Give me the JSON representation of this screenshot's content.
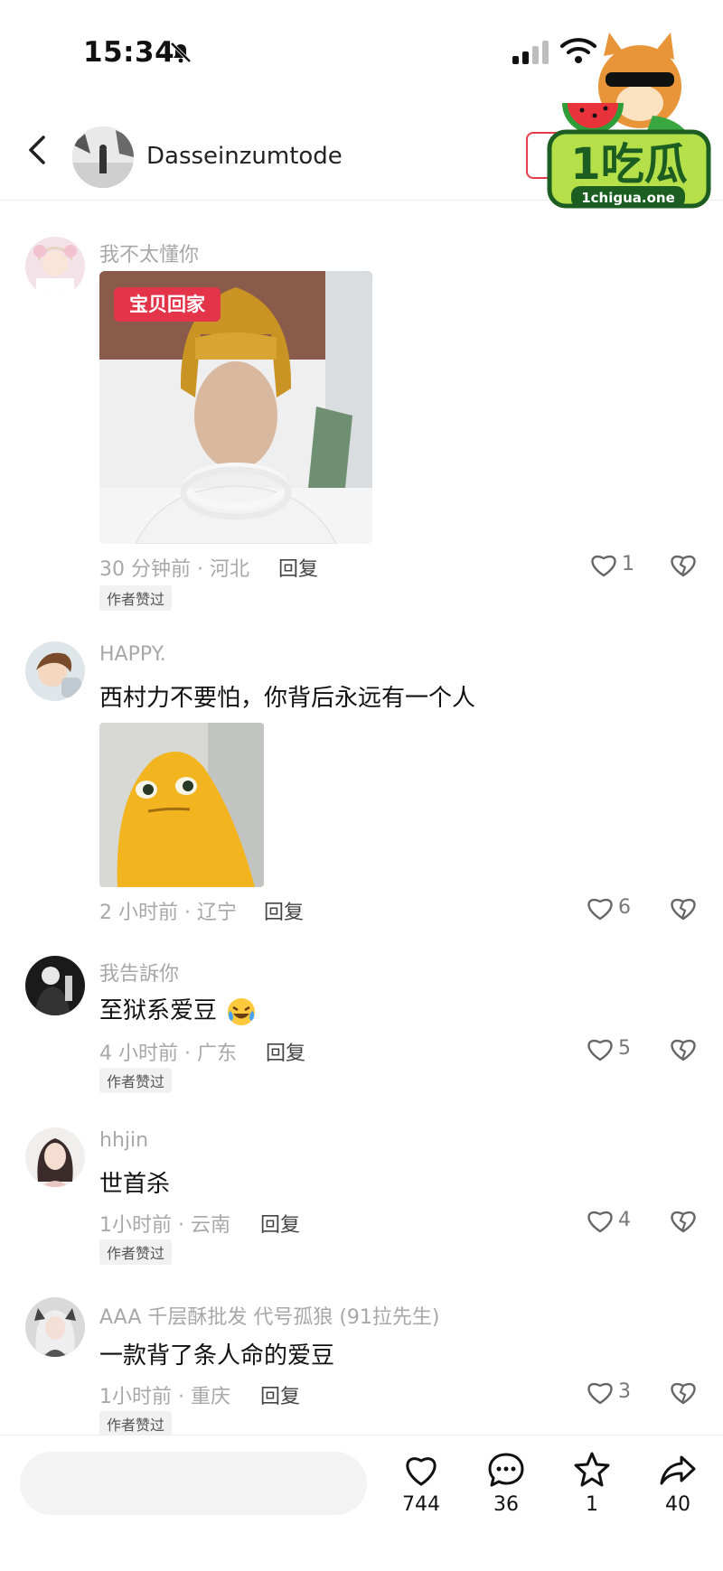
{
  "status_bar": {
    "time": "15:34"
  },
  "header": {
    "username": "Dasseinzumtode"
  },
  "logo": {
    "text": "1吃瓜",
    "subtext": "1chigua.one"
  },
  "image_labels": {
    "meme_tag": "宝贝回家"
  },
  "comments": [
    {
      "username": "我不太懂你",
      "text": "",
      "time_location": "30 分钟前 · 河北",
      "reply_label": "回复",
      "author_liked": "作者赞过",
      "likes": "1"
    },
    {
      "username": "HAPPY.",
      "text": "西村力不要怕，你背后永远有一个人",
      "time_location": "2 小时前 · 辽宁",
      "reply_label": "回复",
      "likes": "6"
    },
    {
      "username": "我告訴你",
      "text": "至狱系爱豆",
      "time_location": "4 小时前 · 广东",
      "reply_label": "回复",
      "author_liked": "作者赞过",
      "likes": "5"
    },
    {
      "username": "hhjin",
      "text": "世首杀",
      "time_location": "1小时前 · 云南",
      "reply_label": "回复",
      "author_liked": "作者赞过",
      "likes": "4"
    },
    {
      "username": "AAA 千层酥批发 代号孤狼 (91拉先生)",
      "text": "一款背了条人命的爱豆",
      "time_location": "1小时前 · 重庆",
      "reply_label": "回复",
      "author_liked": "作者赞过",
      "likes": "3"
    }
  ],
  "bottom_actions": {
    "likes": "744",
    "comments": "36",
    "favorites": "1",
    "shares": "40"
  },
  "colors": {
    "accent": "#e33c4a",
    "meta_gray": "#a8a8a8"
  }
}
